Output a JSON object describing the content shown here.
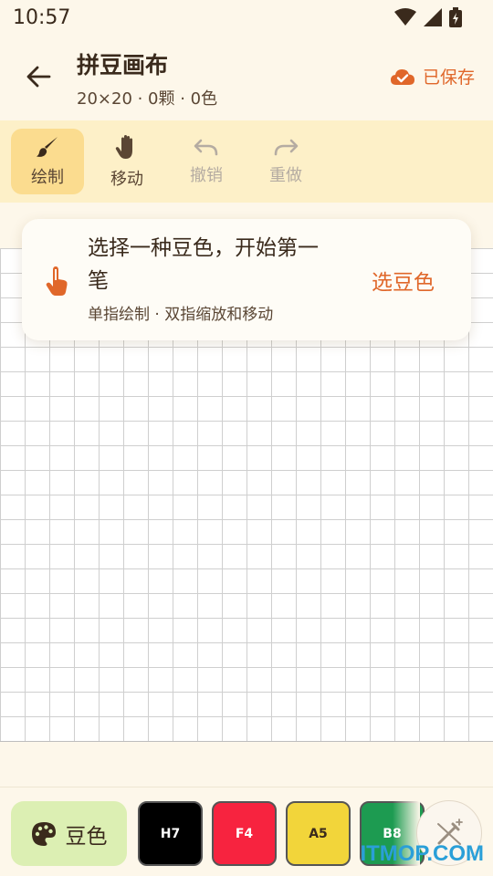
{
  "status_bar": {
    "time": "10:57"
  },
  "header": {
    "title": "拼豆画布",
    "meta": "20×20 · 0颗 · 0色",
    "save_status": "已保存"
  },
  "toolbar": {
    "tools": [
      {
        "label": "绘制",
        "icon": "brush-icon",
        "state": "active"
      },
      {
        "label": "移动",
        "icon": "hand-icon",
        "state": "enabled"
      },
      {
        "label": "撤销",
        "icon": "undo-icon",
        "state": "disabled"
      },
      {
        "label": "重做",
        "icon": "redo-icon",
        "state": "disabled"
      }
    ]
  },
  "hint_card": {
    "title": "选择一种豆色，开始第一笔",
    "subtitle": "单指绘制 · 双指缩放和移动",
    "action": "选豆色"
  },
  "bottom_bar": {
    "palette_label": "豆色",
    "swatches": [
      {
        "code": "H7",
        "color": "#000000",
        "text_color": "#ffffff"
      },
      {
        "code": "F4",
        "color": "#f7233f",
        "text_color": "#ffffff"
      },
      {
        "code": "A5",
        "color": "#f2d53a",
        "text_color": "#3a2a1c"
      },
      {
        "code": "B8",
        "color": "#1d9b51",
        "text_color": "#ffffff"
      }
    ]
  },
  "watermark": "ITMOP.COM",
  "colors": {
    "accent": "#e0672a",
    "toolbar_bg": "#fdf0c8",
    "active_tool_bg": "#fbdc8f",
    "palette_button_bg": "#dcefb3"
  }
}
